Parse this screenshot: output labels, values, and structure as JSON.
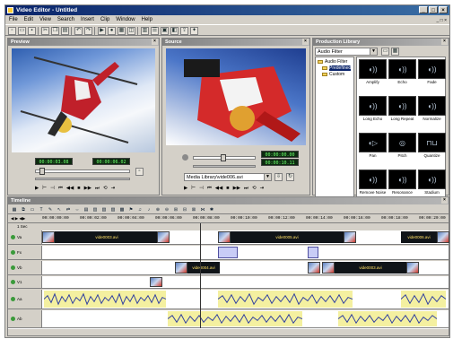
{
  "app": {
    "title": "Video Editor - Untitled"
  },
  "menu": [
    "File",
    "Edit",
    "View",
    "Search",
    "Insert",
    "Clip",
    "Window",
    "Help"
  ],
  "preview": {
    "title": "Preview",
    "timecode_start": "00:00:03.08",
    "timecode_end": "00:00:06.02"
  },
  "source": {
    "title": "Source",
    "timecode_a": "00:00:00.00",
    "timecode_b": "00:00:10.11",
    "clip_select": "Media Library\\vide006.avi"
  },
  "library": {
    "title": "Production Library",
    "category": "Audio Filter",
    "tree": [
      "Audio Filter",
      "Predefined",
      "Custom"
    ],
    "tiles": [
      "Amplify",
      "Echo",
      "Fade",
      "Long Echo",
      "Long Repeat",
      "Normalize",
      "Pan",
      "Pitch",
      "Quantize",
      "Remove Noise",
      "Resonance",
      "Stadium"
    ]
  },
  "timeline": {
    "title": "Timeline",
    "zoom": "1 Sec",
    "ruler": [
      "00:00:00:00",
      "00:00:02:00",
      "00:00:04:00",
      "00:00:06:00",
      "00:00:08:00",
      "00:00:10:00",
      "00:00:12:00",
      "00:00:14:00",
      "00:00:16:00",
      "00:00:18:00",
      "00:00:20:00"
    ],
    "tracks": [
      "Va",
      "Fx",
      "Vb",
      "V1",
      "Aa",
      "Ab"
    ],
    "clips": [
      "vide0003.avi",
      "vide0005.avi",
      "vide0006.avi",
      "vide0004.avi",
      "vide0003.avi"
    ]
  }
}
